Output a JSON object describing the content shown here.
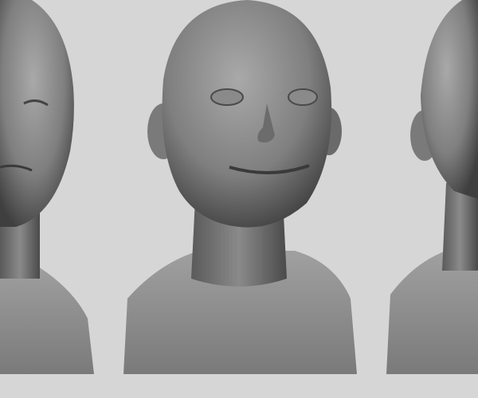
{
  "background_color": "#d6d6d6",
  "model_colors": {
    "highlight": "#a8a8a8",
    "midtone": "#7a7a7a",
    "shadow": "#3e3e3e"
  }
}
